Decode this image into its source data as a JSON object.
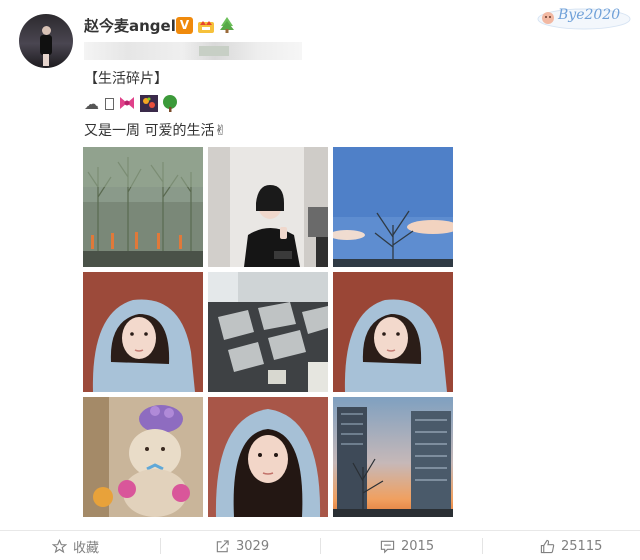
{
  "post": {
    "author": "赵今麦angel",
    "title_line": "【生活碎片】",
    "emoji_row": "☁▯🎀🎆🌳",
    "caption": "又是一周 可爱的生活✌"
  },
  "watermark": {
    "text": "Bye2020"
  },
  "photos": [
    {
      "desc": "trees-building-dusk"
    },
    {
      "desc": "girl-peace-sign-sitting"
    },
    {
      "desc": "blue-sky-bare-tree"
    },
    {
      "desc": "hooded-selfie-1"
    },
    {
      "desc": "sunlight-window-floor-shadows"
    },
    {
      "desc": "hooded-selfie-2"
    },
    {
      "desc": "teddy-bear-with-flower-hat"
    },
    {
      "desc": "hooded-selfie-3"
    },
    {
      "desc": "city-buildings-sunset"
    }
  ],
  "actions": {
    "favorite_label": "收藏",
    "repost_count": "3029",
    "comment_count": "2015",
    "like_count": "25115"
  },
  "colors": {
    "badge_v": "#f08a0c",
    "text_main": "#333333",
    "action_grey": "#808080",
    "watermark_blue": "#6fa0d8"
  }
}
